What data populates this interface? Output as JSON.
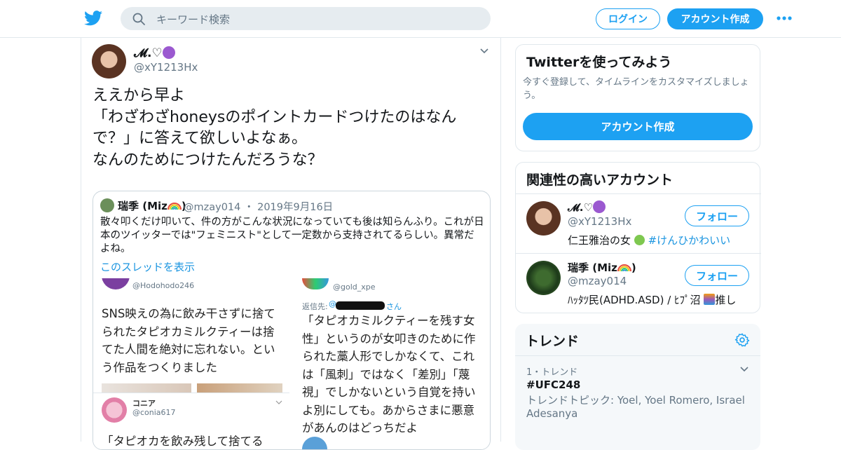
{
  "header": {
    "search_placeholder": "キーワード検索",
    "login_label": "ログイン",
    "signup_label": "アカウント作成",
    "brand_color": "#1da1f2"
  },
  "tweet": {
    "name": "𝓜.♡",
    "handle": "@xY1213Hx",
    "text": "ええから早よ\n「わざわざhoneysのポイントカードつけたのはなんで？」に答えて欲しいよなぁ。\nなんのためにつけたんだろうな？",
    "quote": {
      "name": "瑞季 (Miz",
      "handle": "@mzay014",
      "date": "2019年9月16日",
      "text": "散々叩くだけ叩いて、件の方がこんな状況になっていても後は知らんふり。これが日本のツイッターでは\"フェミニスト\"として一定数から支持されてるらしい。異常だよね。",
      "thread_link": "このスレッドを表示",
      "image": {
        "left_handle": "@Hodohodo246",
        "left_text": "SNS映えの為に飲み干さずに捨てられたタピオカミルクティーは捨てた人間を絶対に忘れない。という作品をつくりました",
        "left_name2": "コニア",
        "left_handle2": "@conia617",
        "left_text2": "「タピオカを飲み残して捨てる",
        "right_handle": "@gold_xpe",
        "right_reply_prefix": "返信先:",
        "right_reply_suffix": "さん",
        "right_text": "「タピオカミルクティーを残す女性」というのが女叩きのために作られた藁人形でしかなくて、これは「風刺」ではなく「差別」「蔑視」でしかないという自覚を持いよ別にしても。あからさまに悪意があんのはどっちだよ"
      }
    }
  },
  "sidebar": {
    "try_card": {
      "title": "Twitterを使ってみよう",
      "subtitle": "今すぐ登録して、タイムラインをカスタマイズしましょう。",
      "button": "アカウント作成"
    },
    "related": {
      "title": "関連性の高いアカウント",
      "follow_label": "フォロー",
      "accounts": [
        {
          "name": "𝓜.♡",
          "handle": "@xY1213Hx",
          "bio": "仁王雅治の女",
          "bio_tag": "#けんひかわいい"
        },
        {
          "name": "瑞季 (Miz",
          "handle": "@mzay014",
          "bio": "ﾊｯﾀﾂ民(ADHD.ASD) / ﾋﾌﾟ沼",
          "bio_tail": "推し"
        }
      ]
    },
    "trends": {
      "title": "トレンド",
      "items": [
        {
          "rank": "1・トレンド",
          "tag": "#UFC248",
          "topic": "トレンドトピック: Yoel, Yoel Romero, Israel Adesanya"
        }
      ]
    }
  }
}
